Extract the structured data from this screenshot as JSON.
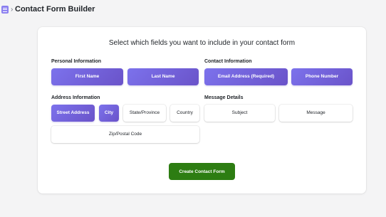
{
  "header": {
    "app_icon": "list-icon",
    "separator_icon": "chevron-right-icon",
    "title": "Contact Form Builder"
  },
  "card": {
    "instruction": "Select which fields you want to include in your contact form",
    "sections": {
      "personal": {
        "title": "Personal Information",
        "fields": [
          {
            "label": "First Name",
            "selected": true
          },
          {
            "label": "Last Name",
            "selected": true
          }
        ]
      },
      "contact": {
        "title": "Contact Information",
        "fields": [
          {
            "label": "Email Address (Required)",
            "selected": true
          },
          {
            "label": "Phone Number",
            "selected": true
          }
        ]
      },
      "address": {
        "title": "Address Information",
        "fields": [
          {
            "label": "Street Address",
            "selected": true
          },
          {
            "label": "City",
            "selected": true
          },
          {
            "label": "State/Province",
            "selected": false
          },
          {
            "label": "Country",
            "selected": false
          },
          {
            "label": "Zip/Postal Code",
            "selected": false
          }
        ]
      },
      "message": {
        "title": "Message Details",
        "fields": [
          {
            "label": "Subject",
            "selected": false
          },
          {
            "label": "Message",
            "selected": false
          }
        ]
      }
    },
    "create_button": "Create Contact Form"
  },
  "colors": {
    "selected_field_start": "#7c72ec",
    "selected_field_end": "#6a53c9",
    "create_button": "#2d7d12",
    "page_background": "#f4f4f5"
  }
}
